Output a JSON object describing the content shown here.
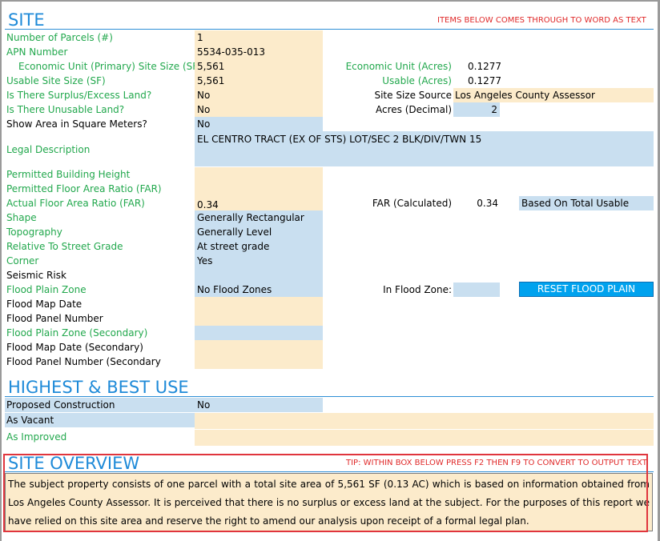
{
  "site": {
    "title": "SITE",
    "note": "ITEMS BELOW COMES THROUGH TO WORD AS TEXT",
    "labels": {
      "parcels": "Number of Parcels (#)",
      "apn": "APN Number",
      "econ_unit_size": "Economic Unit (Primary) Site Size (SF)",
      "usable_size": "Usable Site Size (SF)",
      "surplus": "Is There Surplus/Excess Land?",
      "unusable": "Is There Unusable Land?",
      "show_area": "Show Area in Square Meters?",
      "legal": "Legal Description",
      "bldg_height": "Permitted Building Height",
      "permitted_far": "Permitted Floor Area Ratio (FAR)",
      "actual_far": "Actual Floor Area Ratio (FAR)",
      "shape": "Shape",
      "topography": "Topography",
      "street_grade": "Relative To Street Grade",
      "corner": "Corner",
      "seismic": "Seismic Risk",
      "flood_zone": "Flood Plain Zone",
      "flood_map_date": "Flood Map Date",
      "flood_panel": "Flood Panel Number",
      "flood_zone_sec": "Flood Plain Zone (Secondary)",
      "flood_map_date_sec": "Flood Map Date (Secondary)",
      "flood_panel_sec": "Flood Panel Number (Secondary"
    },
    "values": {
      "parcels": "1",
      "apn": "5534-035-013",
      "econ_unit_size": "5,561",
      "usable_size": "5,561",
      "surplus": "No",
      "unusable": "No",
      "show_area": "No",
      "legal": "EL CENTRO TRACT (EX OF STS) LOT/SEC 2 BLK/DIV/TWN 15",
      "bldg_height": "",
      "permitted_far": "",
      "actual_far": "0.34",
      "shape": "Generally Rectangular",
      "topography": "Generally Level",
      "street_grade": "At street grade",
      "corner": "Yes",
      "seismic": "",
      "flood_zone": "No Flood Zones",
      "flood_map_date": "",
      "flood_panel": "",
      "flood_zone_sec": "",
      "flood_map_date_sec": "",
      "flood_panel_sec": ""
    },
    "right": {
      "econ_acres_label": "Economic Unit (Acres)",
      "econ_acres": "0.1277",
      "usable_acres_label": "Usable (Acres)",
      "usable_acres": "0.1277",
      "size_source_label": "Site Size Source",
      "size_source": "Los Angeles County Assessor",
      "acres_decimal_label": "Acres (Decimal)",
      "acres_decimal": "2",
      "far_calc_label": "FAR (Calculated)",
      "far_calc": "0.34",
      "far_basis": "Based On Total Usable",
      "in_flood_zone_label": "In Flood Zone:",
      "in_flood_zone": "",
      "reset_button": "RESET FLOOD PLAIN"
    }
  },
  "hbu": {
    "title": "HIGHEST & BEST USE",
    "labels": {
      "proposed": "Proposed Construction",
      "as_vacant": "As Vacant",
      "as_improved": "As Improved"
    },
    "values": {
      "proposed": "No",
      "as_vacant": "",
      "as_improved": ""
    }
  },
  "overview": {
    "title": "SITE OVERVIEW",
    "tip": "TIP: WITHIN BOX BELOW PRESS F2 THEN F9 TO CONVERT TO OUTPUT TEXT",
    "text": "The subject property consists of one parcel with a total site area of 5,561 SF (0.13 AC) which is based on information obtained from Los Angeles County Assessor. It is perceived that there is no surplus or excess land at the subject. For the purposes of this report we have relied on this site area and reserve the right to amend our analysis upon receipt of a formal legal plan."
  },
  "colors": {
    "accent": "#1e8ad8",
    "green_label": "#22a84d",
    "note_red": "#e02a2a",
    "input_tan": "#fcebcb",
    "input_blue": "#c9dff0",
    "button_blue": "#00a2ee"
  }
}
